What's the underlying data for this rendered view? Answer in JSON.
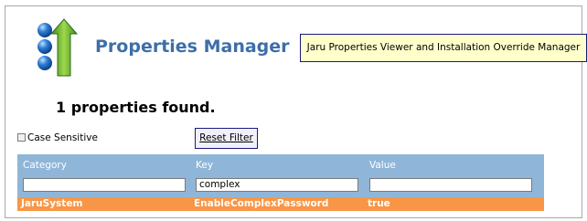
{
  "header": {
    "app_title": "Properties Manager",
    "info_text": "Jaru Properties Viewer and Installation Override Manager"
  },
  "results": {
    "summary": "1 properties found."
  },
  "filters": {
    "case_sensitive_label": "Case Sensitive",
    "case_sensitive_checked": false,
    "reset_label": "Reset Filter"
  },
  "table": {
    "columns": [
      "Category",
      "Key",
      "Value"
    ],
    "filter_values": [
      "",
      "complex",
      ""
    ],
    "rows": [
      [
        "JaruSystem",
        "EnableComplexPassword",
        "true"
      ]
    ]
  },
  "colors": {
    "title": "#3d6fa8",
    "grid_header": "#8fb6d8",
    "selected_row": "#f79646",
    "info_box": "#ffffcc"
  },
  "icons": {
    "logo": "blue-spheres-green-arrow-logo"
  }
}
